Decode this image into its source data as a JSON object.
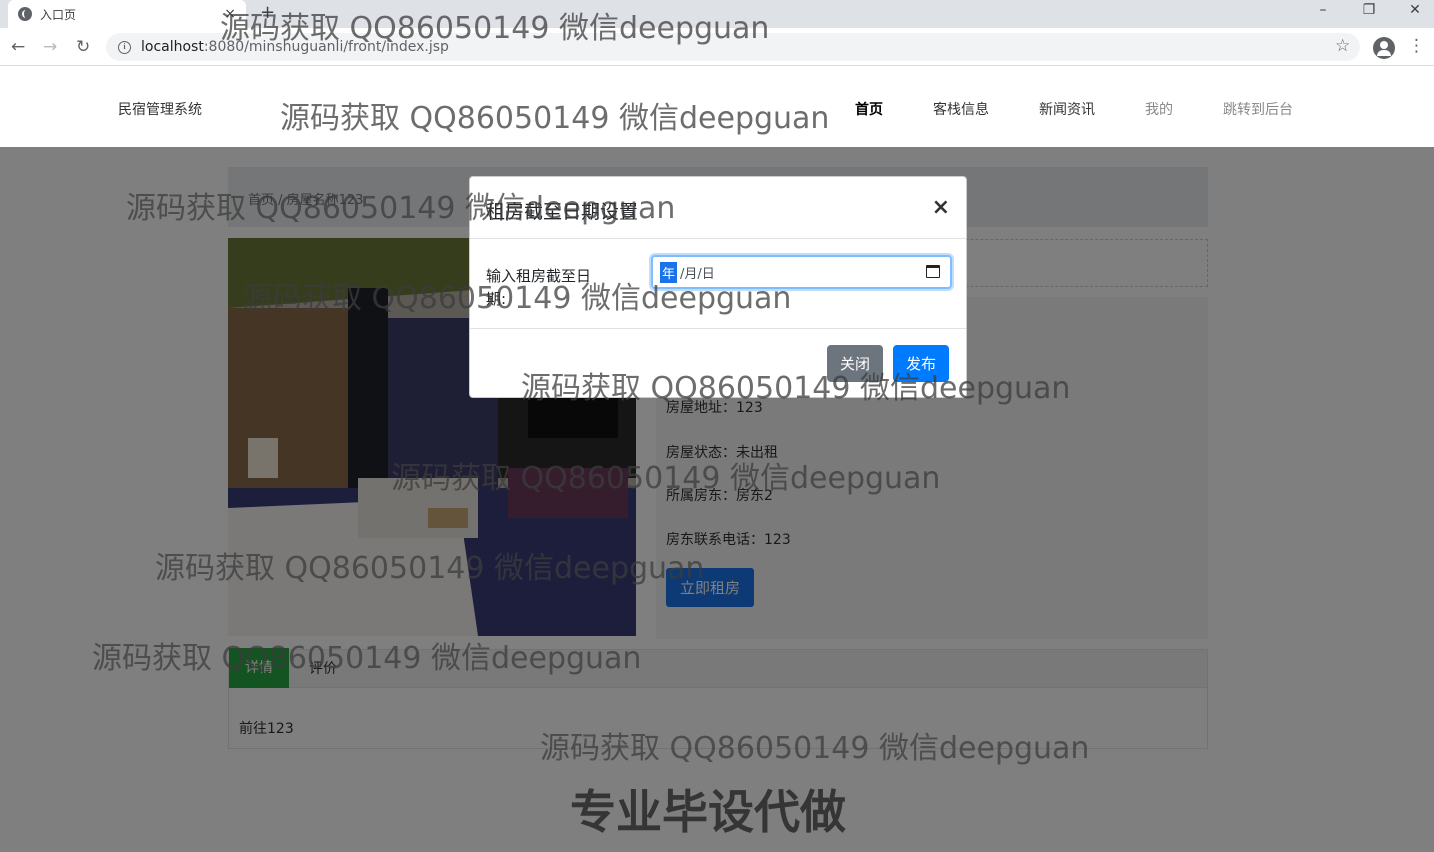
{
  "browser": {
    "tab_title": "入口页",
    "tab_close": "×",
    "new_tab": "+",
    "url_host": "localhost",
    "url_rest": ":8080/minshuguanli/front/index.jsp",
    "win_minimize": "–",
    "win_restore": "❐",
    "win_close": "✕",
    "back": "←",
    "forward": "→",
    "reload": "↻",
    "star": "☆",
    "menu": "⋮"
  },
  "navbar": {
    "brand": "民宿管理系统",
    "links": [
      "首页",
      "客栈信息",
      "新闻资讯",
      "我的",
      "跳转到后台"
    ]
  },
  "page": {
    "breadcrumb": "首页 / 房屋名称123",
    "info": {
      "address": "房屋地址：123",
      "status": "房屋状态：未出租",
      "landlord": "所属房东：房东2",
      "phone": "房东联系电话：123"
    },
    "rent_button": "立即租房",
    "tabs": [
      "详情",
      "评价"
    ],
    "detail_text": "前往123"
  },
  "modal": {
    "title": "租房截至日期设置",
    "close_symbol": "×",
    "field_label": "输入租房截至日期:",
    "date_year": "年",
    "date_rest": "/月/日",
    "close_button": "关闭",
    "publish_button": "发布"
  },
  "watermarks": {
    "qq": "源码获取 QQ86050149 微信deepguan",
    "bottom": "专业毕设代做"
  }
}
